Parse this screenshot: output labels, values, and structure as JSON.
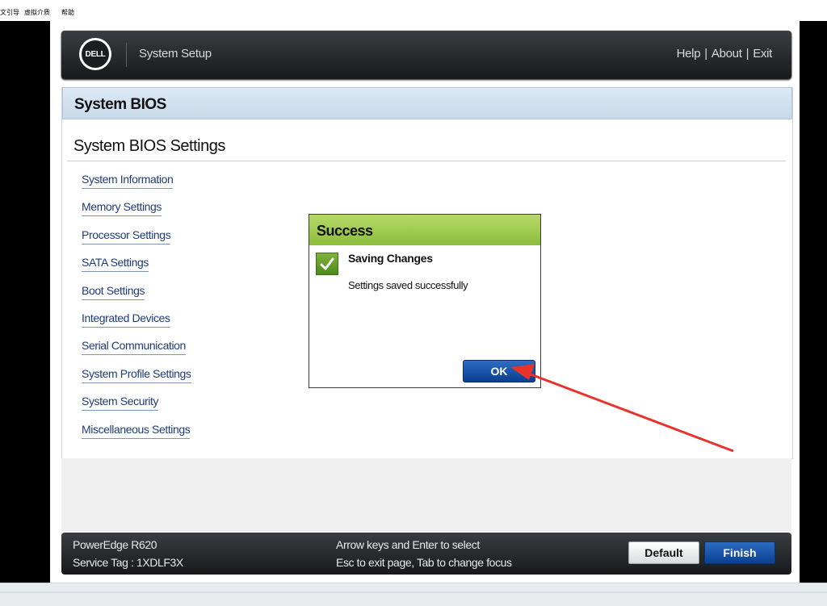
{
  "host_menu": {
    "items": [
      "文引导",
      "虚拟介质",
      "帮助"
    ]
  },
  "header": {
    "logo_text": "DELL",
    "title": "System Setup",
    "links": [
      "Help",
      "About",
      "Exit"
    ],
    "separator": "|"
  },
  "page": {
    "title": "System BIOS",
    "heading": "System BIOS Settings",
    "menu": [
      "System Information",
      "Memory Settings",
      "Processor Settings",
      "SATA Settings",
      "Boot Settings",
      "Integrated Devices",
      "Serial Communication",
      "System Profile Settings",
      "System Security",
      "Miscellaneous Settings"
    ]
  },
  "dialog": {
    "title": "Success",
    "heading": "Saving Changes",
    "message": "Settings saved successfully",
    "ok_label": "OK",
    "icon": "check-icon",
    "title_color": "#9bc84a"
  },
  "footer": {
    "model": "PowerEdge R620",
    "service_tag": "Service Tag : 1XDLF3X",
    "hint1": "Arrow keys and Enter to select",
    "hint2": "Esc to exit page, Tab to change focus",
    "default_label": "Default",
    "finish_label": "Finish"
  },
  "annotation": {
    "arrow_color": "#e8322b"
  }
}
